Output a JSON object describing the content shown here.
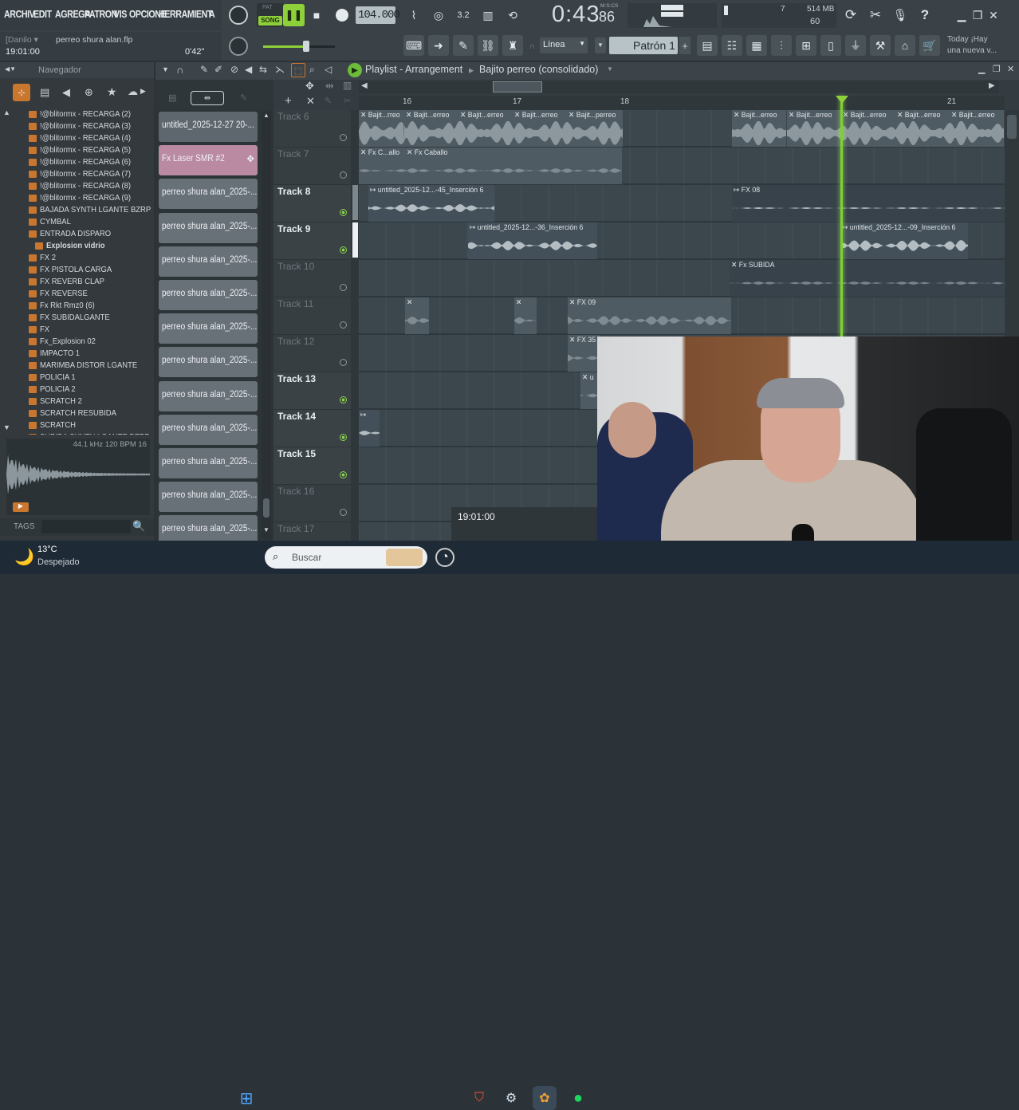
{
  "menu": [
    "ARCHIV",
    "EDIT",
    "AGREGA",
    "PATRON",
    "VIS",
    "OPCIONE",
    "HERRAMIENT",
    "A"
  ],
  "transport": {
    "song_label": "SONG",
    "pat_label": "PAT",
    "tempo": "104.000",
    "time": "0:43",
    "time_sub": "86",
    "msc": "M:S:CS"
  },
  "memory": {
    "mb": "514 MB",
    "poly": "7",
    "cpu": "60"
  },
  "project": {
    "user": "[Danilo ▾",
    "file": "perreo shura alan.flp",
    "position": "19:01:00",
    "length": "0'42\""
  },
  "toolbar": {
    "snap": "Línea",
    "pattern": "Patrón 1"
  },
  "news": {
    "line1": "Today ¡Hay",
    "line2": "una nueva v..."
  },
  "browser": {
    "title": "Navegador",
    "items": [
      "!@blitormx - RECARGA (2)",
      "!@blitormx - RECARGA (3)",
      "!@blitormx - RECARGA (4)",
      "!@blitormx - RECARGA (5)",
      "!@blitormx - RECARGA (6)",
      "!@blitormx - RECARGA (7)",
      "!@blitormx - RECARGA (8)",
      "!@blitormx - RECARGA (9)",
      "BAJADA SYNTH LGANTE BZRP",
      "CYMBAL",
      "ENTRADA DISPARO",
      "Explosion vidrio",
      "FX 2",
      "FX PISTOLA CARGA",
      "FX REVERB CLAP",
      "FX REVERSE",
      "Fx Rkt Rmz0 (6)",
      "FX SUBIDALGANTE",
      "FX",
      "Fx_Explosion 02",
      "IMPACTO 1",
      "MARIMBA DISTOR LGANTE",
      "POLICIA 1",
      "POLICIA 2",
      "SCRATCH 2",
      "SCRATCH RESUBIDA",
      "SCRATCH",
      "SUBIDA SYNTH LGANTE BZRP"
    ],
    "sample_info": "44.1 kHz 120 BPM 16",
    "tags": "TAGS"
  },
  "playlist": {
    "title": "Playlist - Arrangement",
    "arrow": "▸",
    "subtitle": "Bajito perreo (consolidado)",
    "bars": [
      "16",
      "17",
      "18",
      "21"
    ]
  },
  "patterns": [
    "untitled_2025-12-27 20-...",
    "Fx Laser SMR #2",
    "perreo shura alan_2025-...",
    "perreo shura alan_2025-...",
    "perreo shura alan_2025-...",
    "perreo shura alan_2025-...",
    "perreo shura alan_2025-...",
    "perreo shura alan_2025-...",
    "perreo shura alan_2025-...",
    "perreo shura alan_2025-...",
    "perreo shura alan_2025-...",
    "perreo shura alan_2025-...",
    "perreo shura alan_2025-..."
  ],
  "tracks": [
    {
      "name": "Track 6"
    },
    {
      "name": "Track 7"
    },
    {
      "name": "Track 8"
    },
    {
      "name": "Track 9"
    },
    {
      "name": "Track 10"
    },
    {
      "name": "Track 11"
    },
    {
      "name": "Track 12"
    },
    {
      "name": "Track 13"
    },
    {
      "name": "Track 14"
    },
    {
      "name": "Track 15"
    },
    {
      "name": "Track 16"
    },
    {
      "name": "Track 17"
    }
  ],
  "clips": {
    "bajito_short": "Bajit...rreo",
    "bajito": "Bajit...erreo",
    "bajito_perreo": "Bajit...perreo",
    "fx_callo": "Fx C...allo",
    "fx_caballo": "Fx Caballo",
    "t8": "untitled_2025-12...-45_Inserción 6",
    "fx08": "FX 08",
    "t9a": "untitled_2025-12...-36_Inserción 6",
    "t9b": "untitled_2025-12...-09_Inserción 6",
    "fxsubida": "Fx SUBIDA",
    "fx09": "FX 09",
    "fx35": "FX 35",
    "u": "u"
  },
  "hint": "19:01:00",
  "taskbar": {
    "temp": "13°C",
    "weather": "Despejado",
    "search": "Buscar"
  }
}
